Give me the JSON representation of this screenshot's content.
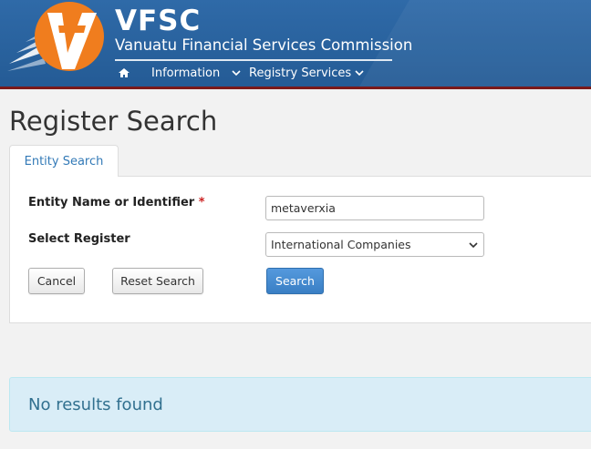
{
  "brand": {
    "name": "VFSC",
    "subtitle": "Vanuatu Financial Services Commission"
  },
  "nav": {
    "items": [
      {
        "label": "Information"
      },
      {
        "label": "Registry Services"
      }
    ]
  },
  "page": {
    "title": "Register Search"
  },
  "tabs": [
    {
      "label": "Entity Search",
      "active": true
    }
  ],
  "form": {
    "entity_label": "Entity Name or Identifier",
    "required_marker": "*",
    "entity_value": "metaverxia",
    "register_label": "Select Register",
    "register_selected": "International Companies"
  },
  "buttons": {
    "cancel": "Cancel",
    "reset": "Reset Search",
    "search": "Search"
  },
  "results": {
    "message": "No results found"
  },
  "colors": {
    "header_blue": "#2f6aa8",
    "header_border": "#7a1a1a",
    "logo_orange": "#f07d1e",
    "link_blue": "#337ab7",
    "primary_button": "#3a7fc4",
    "alert_bg": "#d9edf7",
    "alert_text": "#31708f",
    "required_red": "#cc2222"
  },
  "icons": [
    "vfsc-logo",
    "home-icon",
    "chevron-down-icon"
  ]
}
